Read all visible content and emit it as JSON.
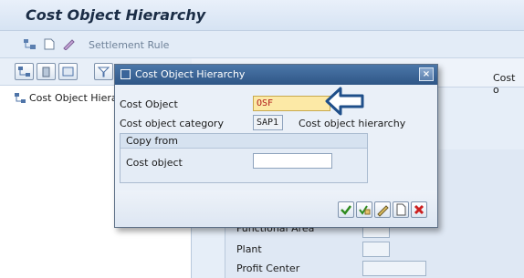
{
  "window": {
    "title": "Cost Object Hierarchy"
  },
  "app_toolbar": {
    "settlement_rule_label": "Settlement Rule"
  },
  "tree": {
    "root_label": "Cost Object Hierarchy"
  },
  "right_header": {
    "truncated_label": "Cost o"
  },
  "form_rows": [
    {
      "label": "Functional Area"
    },
    {
      "label": "Plant"
    },
    {
      "label": "Profit Center"
    }
  ],
  "dialog": {
    "title": "Cost Object Hierarchy",
    "close_label": "×",
    "cost_object": {
      "label": "Cost Object",
      "value": "OSF"
    },
    "category": {
      "label": "Cost object category",
      "value": "SAP1",
      "description": "Cost object hierarchy"
    },
    "copy_from": {
      "group_title": "Copy from",
      "cost_object_label": "Cost object",
      "cost_object_value": ""
    }
  },
  "colors": {
    "active_field": "#fce9a6",
    "dialog_title": "#2f5686",
    "arrow": "#1f4f8a"
  }
}
